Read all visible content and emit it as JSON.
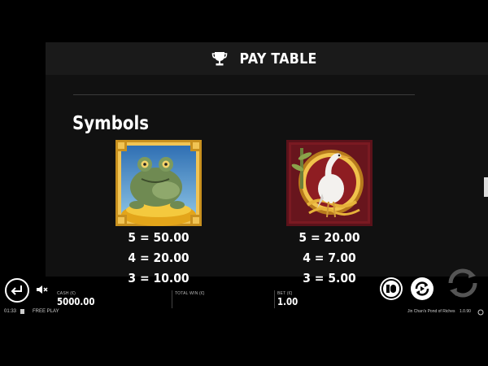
{
  "header": {
    "title": "PAY TABLE",
    "icon": "trophy-icon"
  },
  "section": {
    "title": "Symbols"
  },
  "symbols": [
    {
      "name": "Golden Toad",
      "icon": "toad-symbol-icon",
      "pays": [
        {
          "count": 5,
          "label": "5 = 50.00"
        },
        {
          "count": 4,
          "label": "4 = 20.00"
        },
        {
          "count": 3,
          "label": "3 = 10.00"
        }
      ]
    },
    {
      "name": "Crane",
      "icon": "crane-symbol-icon",
      "pays": [
        {
          "count": 5,
          "label": "5 = 20.00"
        },
        {
          "count": 4,
          "label": "4 = 7.00"
        },
        {
          "count": 3,
          "label": "3 = 5.00"
        }
      ]
    }
  ],
  "hud": {
    "cash_label": "CASH (€)",
    "cash_value": "5000.00",
    "total_win_label": "TOTAL WIN (€)",
    "total_win_value": "",
    "bet_label": "BET (€)",
    "bet_value": "1.00"
  },
  "footer": {
    "time": "01:33",
    "mode": "FREE PLAY",
    "game_name": "Jin Chan's Pond of Riches",
    "version": "1.0.90"
  },
  "colors": {
    "background": "#000000",
    "header_bg": "#1a1a1a",
    "content_bg": "#111111",
    "gold": "#d9a520",
    "crane_bg": "#7a1a22"
  }
}
